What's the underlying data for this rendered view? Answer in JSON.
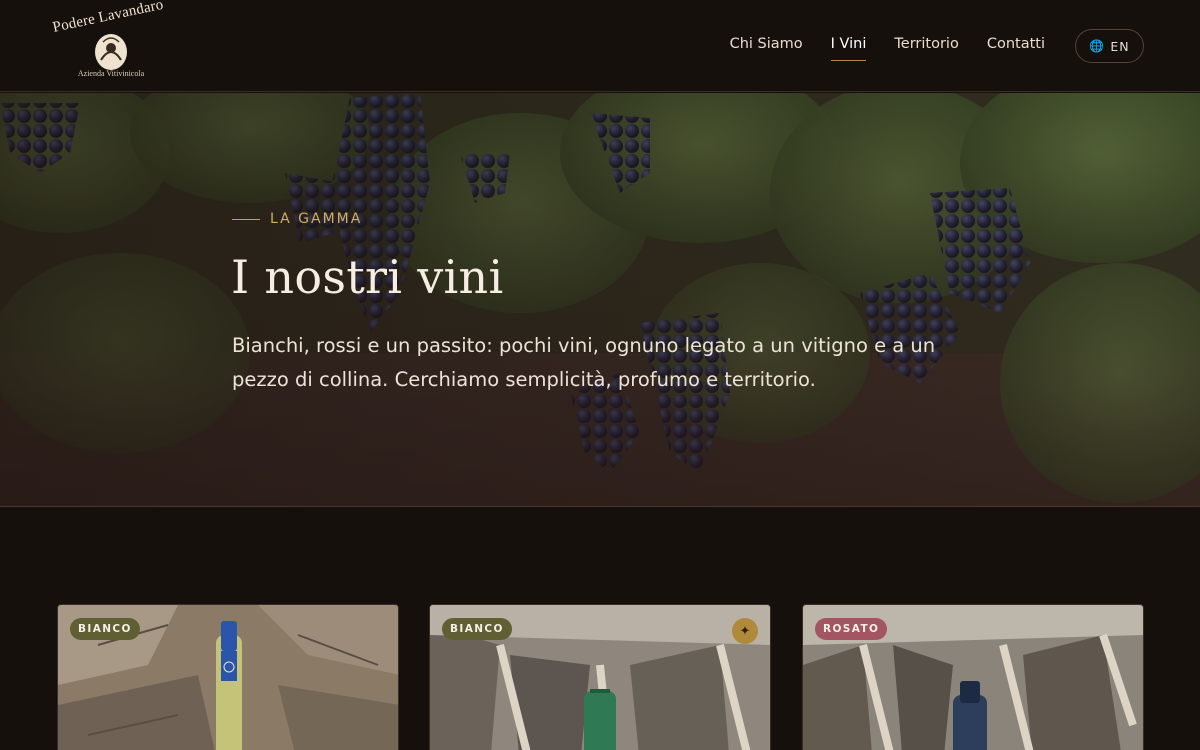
{
  "brand": {
    "name": "Podere Lavandaro",
    "tagline": "Azienda Vitivinicola"
  },
  "nav": {
    "items": [
      {
        "label": "Chi Siamo",
        "active": false
      },
      {
        "label": "I Vini",
        "active": true
      },
      {
        "label": "Territorio",
        "active": false
      },
      {
        "label": "Contatti",
        "active": false
      }
    ],
    "language": {
      "icon": "globe-icon",
      "label": "EN"
    }
  },
  "hero": {
    "eyebrow": "LA GAMMA",
    "title": "I nostri vini",
    "description": "Bianchi, rossi e un passito: pochi vini, ognuno legato a un vitigno e a un pezzo di collina. Cerchiamo semplicità, profumo e territorio."
  },
  "wines": [
    {
      "badge": "BIANCO",
      "featured": false,
      "bottle_color": "#2a55a8"
    },
    {
      "badge": "BIANCO",
      "featured": true,
      "featured_icon": "star-icon",
      "bottle_color": "#2f7a55"
    },
    {
      "badge": "ROSATO",
      "featured": false,
      "bottle_color": "#2c3e5c"
    }
  ],
  "colors": {
    "background": "#16100d",
    "accent_gold": "#c4a15a",
    "badge_bianco": "#5f5f33",
    "badge_rosato": "#a35563"
  }
}
